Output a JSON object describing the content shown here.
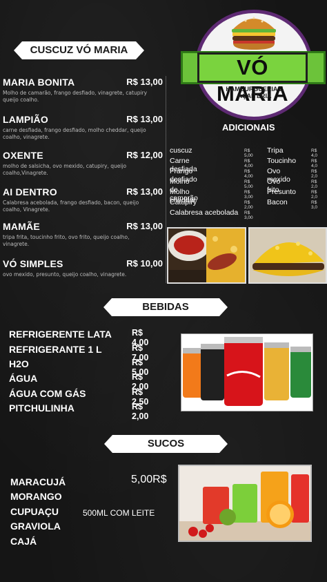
{
  "menu": {
    "header": "CUSCUZ VÓ MARIA",
    "items": [
      {
        "name": "MARIA BONITA",
        "price": "R$ 13,00",
        "desc": "Molho de camarão, frango desfiado, vinagrete, catupiry queijo coalho."
      },
      {
        "name": "LAMPIÃO",
        "price": "R$ 13,00",
        "desc": "carne desfiada, frango desfiado, molho cheddar, queijo coalho, vinagrete."
      },
      {
        "name": "OXENTE",
        "price": "R$ 12,00",
        "desc": "molho de salsicha, ovo mexido, catupiry, queijo coalho,Vinagrete."
      },
      {
        "name": "AI DENTRO",
        "price": "R$ 13,00",
        "desc": "Calabresa acebolada, frango desfiado, bacon, queijo coalho, Vinagrete."
      },
      {
        "name": "MAMÃE",
        "price": "R$ 13,00",
        "desc": "tripa frita, toucinho frito, ovo frito, queijo coalho, vinagrete."
      },
      {
        "name": "VÓ SIMPLES",
        "price": "R$ 10,00",
        "desc": "ovo mexido, presunto, queijo coalho, vinagrete."
      }
    ]
  },
  "logo": {
    "title": "VÓ MARIA",
    "subtitle": "HAMBURGUERIA E AÇAITERIA",
    "colors": {
      "ring": "#5e2a73",
      "ribbon": "#7ad33e",
      "text": "#0e0e0e"
    }
  },
  "adicionais": {
    "header": "ADICIONAIS",
    "left": [
      {
        "name": "cuscuz",
        "price": "R$ 5,00"
      },
      {
        "name": "Carne desfiada",
        "price": "R$ 4,00"
      },
      {
        "name": "Frango desfiado",
        "price": "R$ 4,00"
      },
      {
        "name": "Molho de camarão",
        "price": "R$ 5,00"
      },
      {
        "name": "Molho cheddar",
        "price": "R$ 3,00"
      },
      {
        "name": "Catupiry",
        "price": "R$ 2,00"
      },
      {
        "name": "Calabresa acebolada",
        "price": "R$ 3,00"
      }
    ],
    "right": [
      {
        "name": "Tripa",
        "price": "R$ 4,0"
      },
      {
        "name": "Toucinho",
        "price": "R$ 4,0"
      },
      {
        "name": "Ovo mexido",
        "price": "R$ 2,0"
      },
      {
        "name": "Ovo frito",
        "price": "R$ 2,0"
      },
      {
        "name": "Presunto",
        "price": "R$ 2,0"
      },
      {
        "name": "Bacon",
        "price": "R$ 3,0"
      }
    ]
  },
  "bebidas": {
    "header": "BEBIDAS",
    "items": [
      {
        "name": "REFRIGERENTE LATA",
        "price": "R$ 4,00"
      },
      {
        "name": "REFRIGERANTE 1 L",
        "price": "R$ 7,00"
      },
      {
        "name": "H2O",
        "price": "R$ 5,00"
      },
      {
        "name": "ÁGUA",
        "price": "R$ 2,00"
      },
      {
        "name": "ÁGUA COM GÁS",
        "price": "R$ 2,50"
      },
      {
        "name": "PITCHULINHA",
        "price": "R$ 2,00"
      }
    ],
    "cans": [
      "Fanta",
      "Coca-Cola zero",
      "Coca-Cola",
      "Guaraná Kuat",
      "Sprite"
    ]
  },
  "sucos": {
    "header": "SUCOS",
    "items": [
      "MARACUJÁ",
      "MORANGO",
      "CUPUAÇU",
      "GRAVIOLA",
      "CAJÁ"
    ],
    "price": "5,00R$",
    "note": "500ML COM LEITE"
  }
}
